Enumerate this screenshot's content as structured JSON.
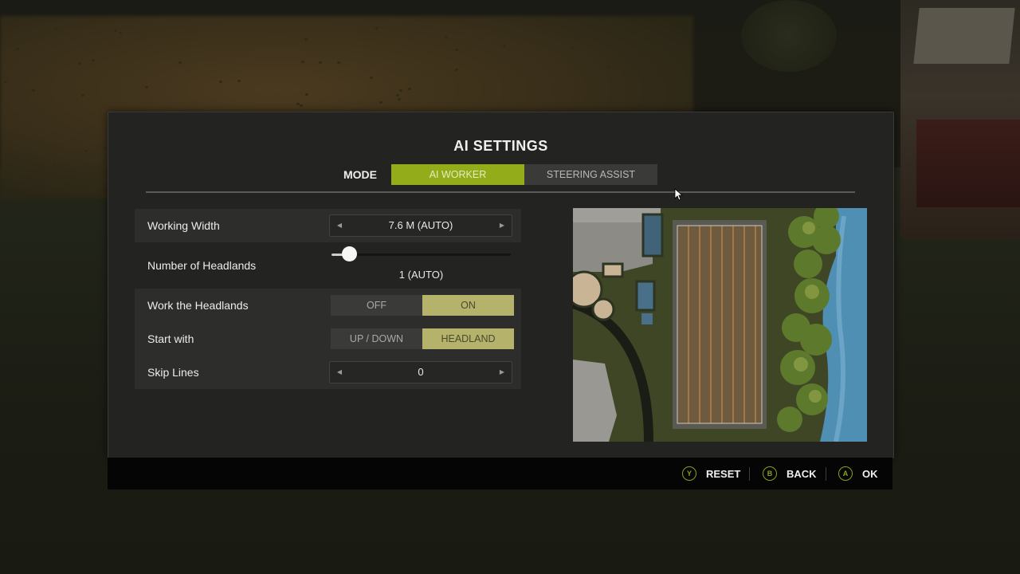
{
  "header": {
    "title": "AI SETTINGS"
  },
  "mode": {
    "label": "MODE",
    "tabs": [
      {
        "label": "AI WORKER",
        "active": true
      },
      {
        "label": "STEERING ASSIST",
        "active": false
      }
    ]
  },
  "settings": {
    "working_width": {
      "label": "Working Width",
      "value": "7.6 M (AUTO)"
    },
    "headlands": {
      "label": "Number of Headlands",
      "value": "1 (AUTO)",
      "slider_level": 0.1
    },
    "work_headlands": {
      "label": "Work the Headlands",
      "options": [
        "OFF",
        "ON"
      ],
      "selected": "ON"
    },
    "start_with": {
      "label": "Start with",
      "options": [
        "UP / DOWN",
        "HEADLAND"
      ],
      "selected": "HEADLAND"
    },
    "skip_lines": {
      "label": "Skip Lines",
      "value": "0"
    }
  },
  "footer": {
    "buttons": [
      {
        "key": "Y",
        "label": "RESET"
      },
      {
        "key": "B",
        "label": "BACK"
      },
      {
        "key": "A",
        "label": "OK"
      }
    ]
  },
  "colors": {
    "accent": "#93ad1a",
    "toggle_selected": "#b5b36b",
    "panel": "#232322",
    "water": "#4f8fb4"
  },
  "icons": {
    "arrow_left": "arrow-left-icon",
    "arrow_right": "arrow-right-icon",
    "cursor": "mouse-cursor-icon"
  }
}
